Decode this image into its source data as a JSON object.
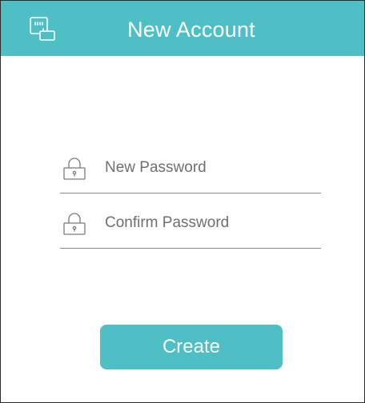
{
  "header": {
    "title": "New Account",
    "icon": "router-icon",
    "background_color": "#4fbfc6"
  },
  "form": {
    "fields": [
      {
        "icon": "lock-icon",
        "placeholder": "New Password",
        "value": ""
      },
      {
        "icon": "lock-icon",
        "placeholder": "Confirm Password",
        "value": ""
      }
    ]
  },
  "actions": {
    "create_label": "Create",
    "button_color": "#4fbfc6"
  }
}
